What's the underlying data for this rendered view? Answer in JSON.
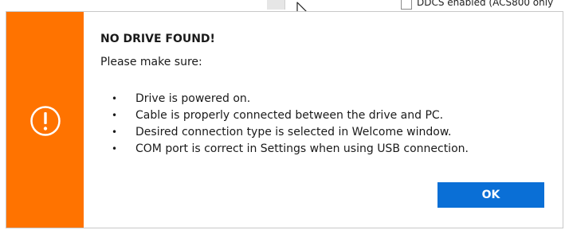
{
  "background": {
    "partial_label": "DDCS enabled (ACS800 only"
  },
  "dialog": {
    "accent_color": "#ff7300",
    "icon": "exclamation-circle-icon",
    "title": "NO DRIVE FOUND!",
    "subtitle": "Please make sure:",
    "bullet_glyph": "•",
    "items": [
      "Drive is powered on.",
      "Cable is properly connected between the drive and PC.",
      "Desired connection type is selected in Welcome window.",
      "COM port is correct in Settings when using USB connection."
    ],
    "ok_label": "OK",
    "ok_color": "#0a6fd6"
  }
}
